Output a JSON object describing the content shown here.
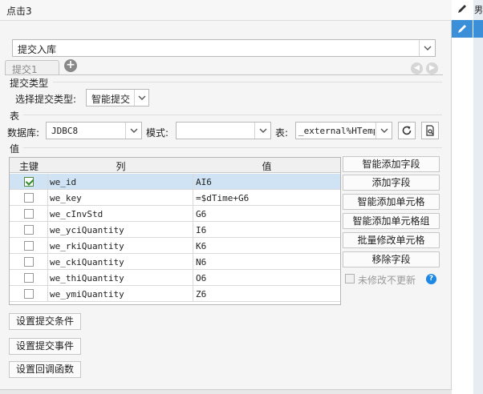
{
  "title": "点击3",
  "submit_mode": {
    "value": "提交入库"
  },
  "tabs": [
    {
      "label": "提交1"
    }
  ],
  "submit_type": {
    "section": "提交类型",
    "label": "选择提交类型:",
    "value": "智能提交"
  },
  "table_section": {
    "section": "表",
    "db_label": "数据库:",
    "db_value": "JDBC8",
    "schema_label": "模式:",
    "schema_value": "",
    "table_label": "表:",
    "table_value": "_external%HTemp"
  },
  "values_section": {
    "section": "值"
  },
  "grid": {
    "headers": {
      "key": "主键",
      "column": "列",
      "value": "值"
    },
    "rows": [
      {
        "key": true,
        "column": "we_id",
        "value": "AI6",
        "selected": true
      },
      {
        "key": false,
        "column": "we_key",
        "value": "=$dTime+G6"
      },
      {
        "key": false,
        "column": "we_cInvStd",
        "value": "G6"
      },
      {
        "key": false,
        "column": "we_yciQuantity",
        "value": "I6"
      },
      {
        "key": false,
        "column": "we_rkiQuantity",
        "value": "K6"
      },
      {
        "key": false,
        "column": "we_ckiQuantity",
        "value": "N6"
      },
      {
        "key": false,
        "column": "we_thiQuantity",
        "value": "O6"
      },
      {
        "key": false,
        "column": "we_ymiQuantity",
        "value": "Z6"
      }
    ]
  },
  "side_actions": {
    "smart_add_field": "智能添加字段",
    "add_field": "添加字段",
    "smart_add_cell": "智能添加单元格",
    "smart_add_cell_group": "智能添加单元格组",
    "batch_modify_cell": "批量修改单元格",
    "remove_field": "移除字段",
    "unmodified_no_update": "未修改不更新"
  },
  "bottom_actions": {
    "set_condition": "设置提交条件",
    "set_event": "设置提交事件",
    "set_callback": "设置回调函数"
  },
  "sidebar": {
    "strip_text": "男"
  },
  "colors": {
    "accent": "#3a8fd8",
    "selection": "#cfe3f5",
    "help": "#1e88e5"
  }
}
